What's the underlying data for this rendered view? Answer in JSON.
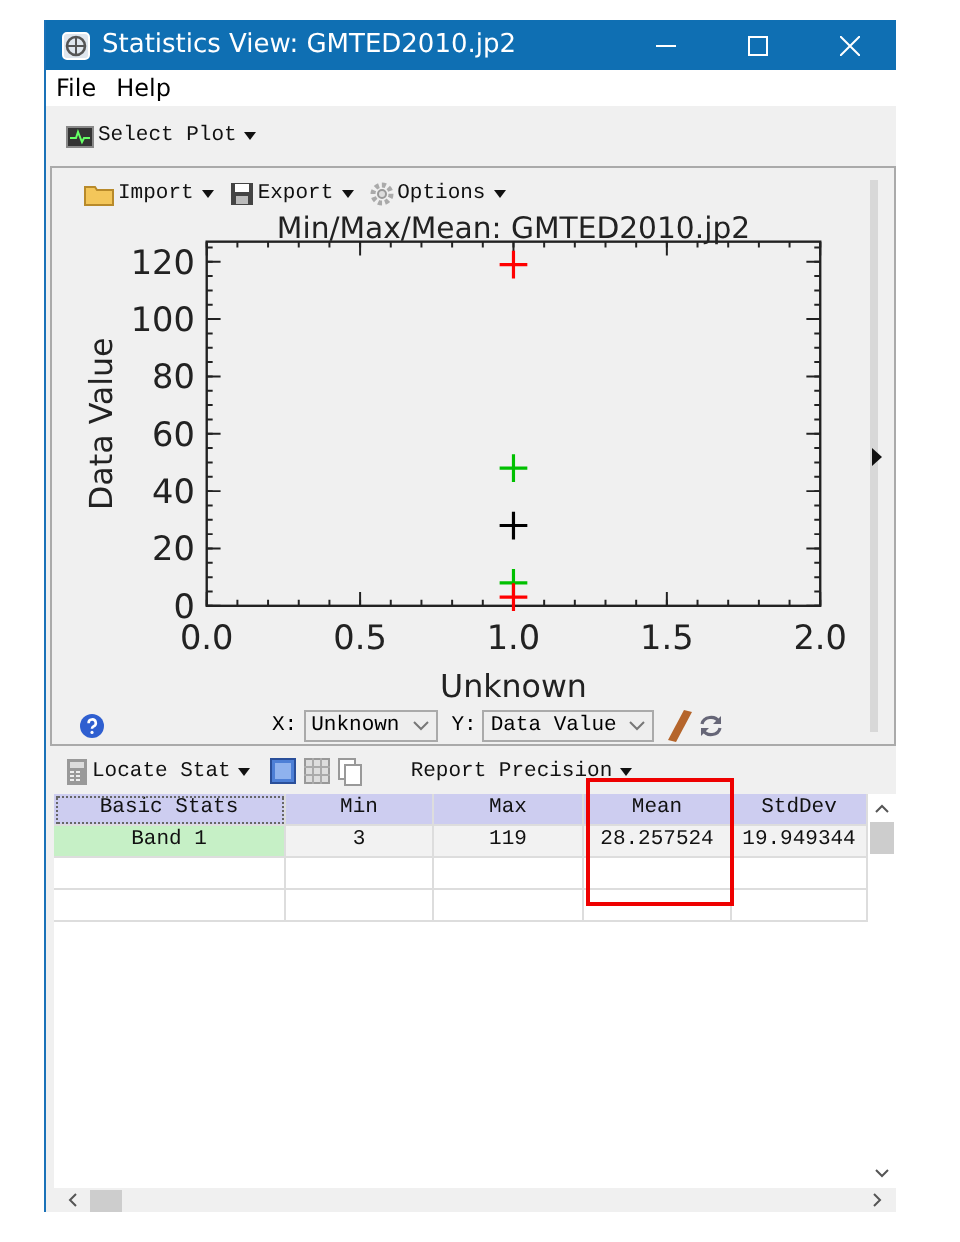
{
  "window": {
    "title": "Statistics View: GMTED2010.jp2"
  },
  "menu": [
    "File",
    "Help"
  ],
  "toolbar": {
    "select_plot": "Select Plot"
  },
  "plot": {
    "toolbar": [
      "Import",
      "Export",
      "Options"
    ],
    "chart_data": {
      "type": "scatter",
      "title": "Min/Max/Mean: GMTED2010.jp2",
      "xlabel": "Unknown",
      "ylabel": "Data Value",
      "x": [
        1
      ],
      "xlim": [
        0,
        2
      ],
      "ylim": [
        0,
        127
      ],
      "xticks": [
        {
          "value": 0,
          "label": "0.0"
        },
        {
          "value": 0.5,
          "label": "0.5"
        },
        {
          "value": 1,
          "label": "1.0"
        },
        {
          "value": 1.5,
          "label": "1.5"
        },
        {
          "value": 2,
          "label": "2.0"
        }
      ],
      "yticks": [
        0,
        20,
        40,
        60,
        80,
        100,
        120
      ],
      "series": [
        {
          "color": "#ff0000",
          "values": [
            119
          ]
        },
        {
          "color": "#00c000",
          "values": [
            48
          ]
        },
        {
          "color": "#000000",
          "values": [
            28
          ]
        },
        {
          "color": "#00c000",
          "values": [
            8
          ]
        },
        {
          "color": "#ff0000",
          "values": [
            3
          ]
        }
      ]
    },
    "x_selector": {
      "label": "X:",
      "value": "Unknown"
    },
    "y_selector": {
      "label": "Y:",
      "value": "Data Value"
    }
  },
  "stats_toolbar": {
    "locate": "Locate Stat",
    "precision": "Report Precision"
  },
  "table": {
    "columns": [
      "Basic Stats",
      "Min",
      "Max",
      "Mean",
      "StdDev"
    ],
    "rows": [
      [
        "Band 1",
        "3",
        "119",
        "28.257524",
        "19.949344"
      ]
    ]
  }
}
